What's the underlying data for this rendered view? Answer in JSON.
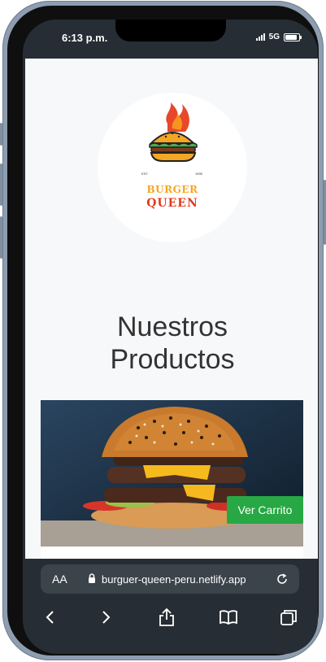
{
  "status_bar": {
    "time": "6:13 p.m.",
    "network": "5G"
  },
  "brand": {
    "logo_top": "BURGER",
    "logo_bottom": "QUEEN",
    "est_left": "EST.",
    "est_right": "1995",
    "colors": {
      "orange": "#f5a623",
      "red": "#e43a1c"
    }
  },
  "page": {
    "title_line1": "Nuestros",
    "title_line2": "Productos"
  },
  "product": {
    "image_alt": "burger-photo",
    "cart_button": "Ver Carrito",
    "cart_button_color": "#27a844"
  },
  "browser": {
    "text_size_label": "AA",
    "url": "burguer-queen-peru.netlify.app",
    "toolbar_icons": [
      "back-icon",
      "forward-icon",
      "share-icon",
      "bookmarks-icon",
      "tabs-icon"
    ]
  }
}
